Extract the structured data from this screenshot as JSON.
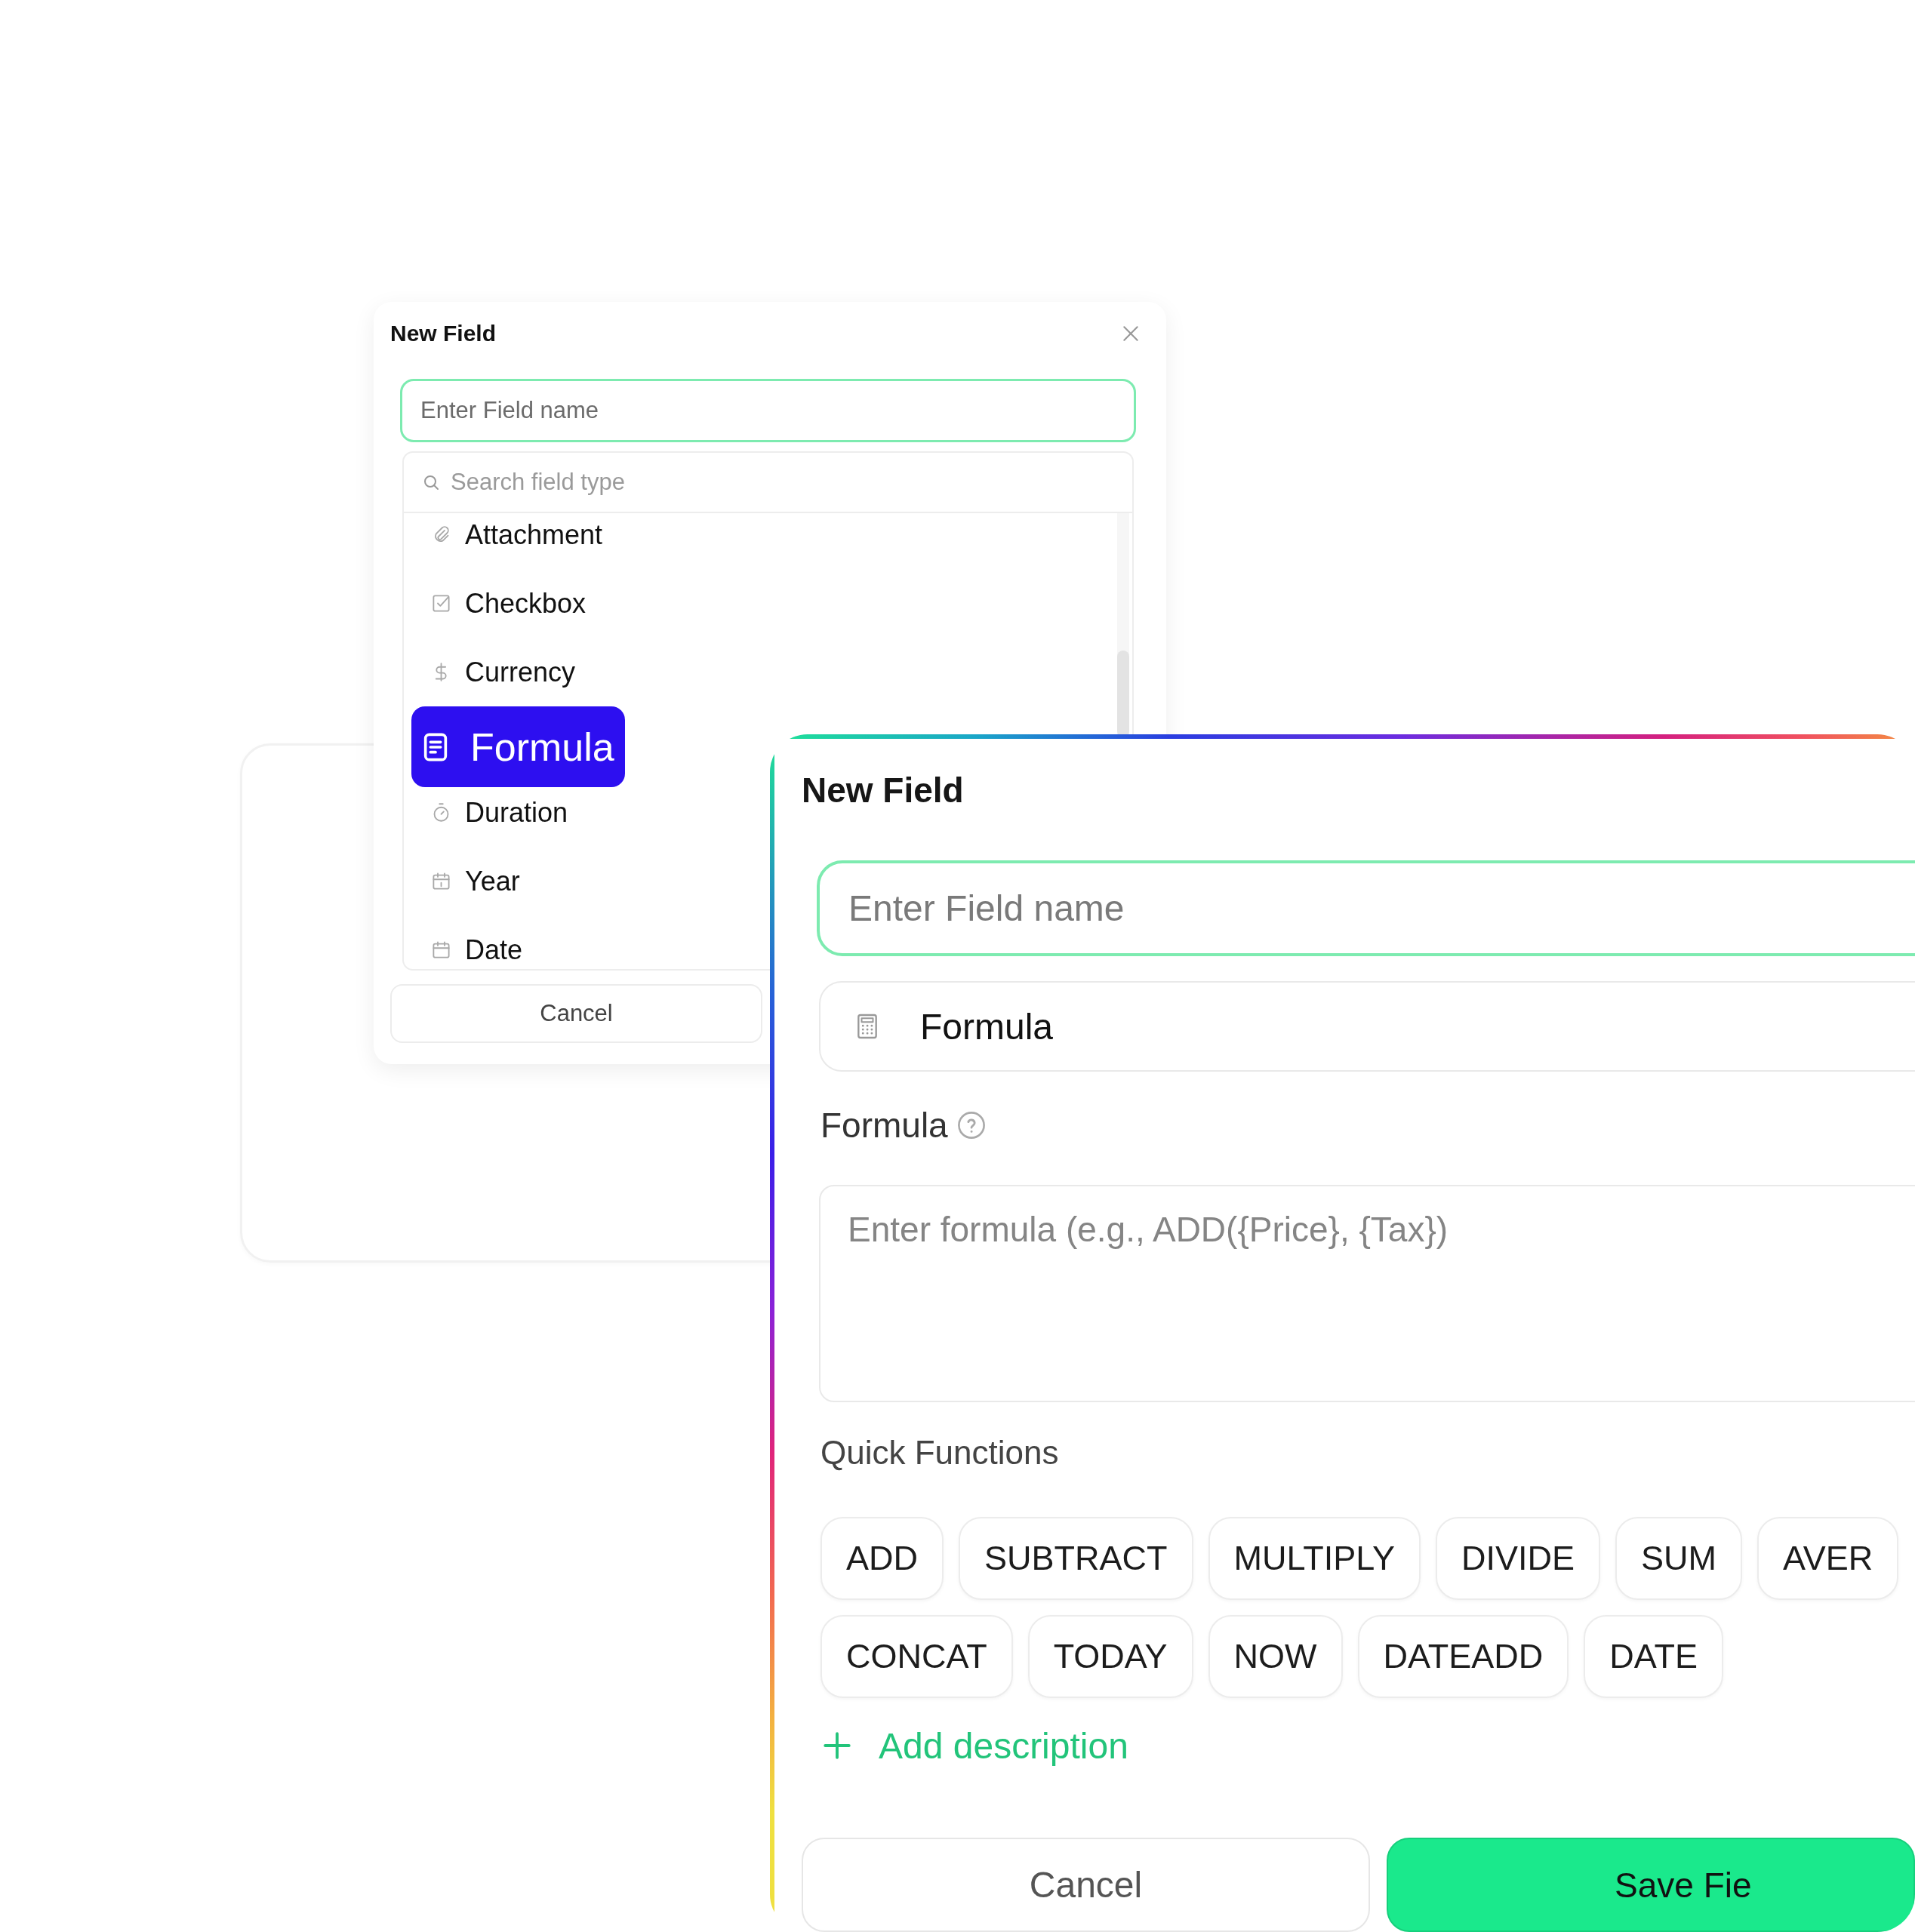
{
  "back_dialog": {
    "title": "New Field",
    "name_field": {
      "placeholder": "Enter Field name"
    },
    "type_search": {
      "placeholder": "Search field type"
    },
    "field_types": [
      {
        "label": "Attachment",
        "kind": "attachment",
        "selected": false
      },
      {
        "label": "Checkbox",
        "kind": "checkbox",
        "selected": false
      },
      {
        "label": "Currency",
        "kind": "currency",
        "selected": false
      },
      {
        "label": "Formula",
        "kind": "formula",
        "selected": true
      },
      {
        "label": "Duration",
        "kind": "duration",
        "selected": false
      },
      {
        "label": "Year",
        "kind": "year",
        "selected": false
      },
      {
        "label": "Date",
        "kind": "date",
        "selected": false
      }
    ],
    "cancel_button": "Cancel"
  },
  "front_dialog": {
    "title": "New Field",
    "name_field": {
      "placeholder": "Enter Field name"
    },
    "field_type": {
      "value": "Formula"
    },
    "formula_label": "Formula",
    "formula_input": {
      "placeholder": "Enter formula (e.g., ADD({Price}, {Tax})"
    },
    "quick_functions_label": "Quick Functions",
    "quick_functions": [
      "ADD",
      "SUBTRACT",
      "MULTIPLY",
      "DIVIDE",
      "SUM",
      "AVER",
      "CONCAT",
      "TODAY",
      "NOW",
      "DATEADD",
      "DATE"
    ],
    "add_description": "Add description",
    "cancel_button": "Cancel",
    "save_button": "Save Fie"
  }
}
